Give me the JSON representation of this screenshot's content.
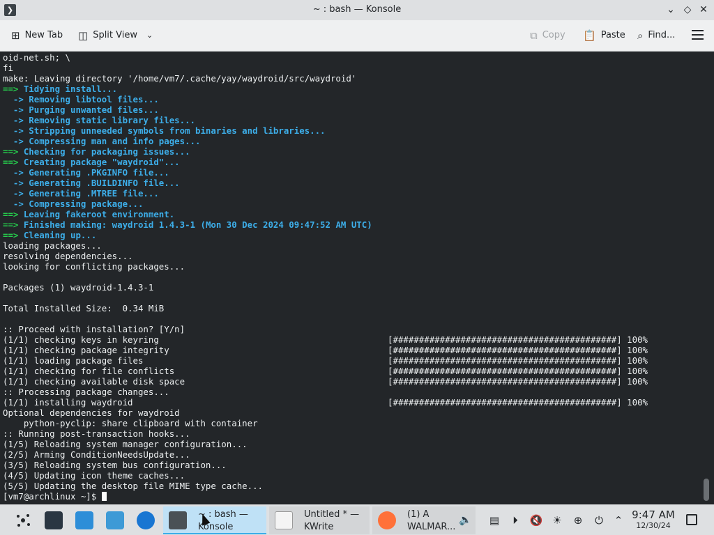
{
  "window": {
    "title": "~ : bash — Konsole",
    "app_icon_glyph": "❯",
    "buttons": {
      "minimize": "⌄",
      "maximize": "◇",
      "close": "✕"
    }
  },
  "toolbar": {
    "new_tab": "New Tab",
    "split_view": "Split View",
    "copy": "Copy",
    "paste": "Paste",
    "find": "Find..."
  },
  "terminal": {
    "colors": {
      "background": "#232629",
      "text": "#eceff0",
      "arrow": "#26cd4d",
      "info": "#3daee9"
    },
    "lines": [
      {
        "t": "oid-net.sh; \\"
      },
      {
        "t": "fi"
      },
      {
        "t": "make: Leaving directory '/home/vm7/.cache/yay/waydroid/src/waydroid'"
      },
      {
        "p": "==>",
        "pc": "arrow",
        "t": " Tidying install...",
        "c": "info"
      },
      {
        "p": "  ->",
        "pc": "info",
        "t": " Removing libtool files...",
        "c": "info"
      },
      {
        "p": "  ->",
        "pc": "info",
        "t": " Purging unwanted files...",
        "c": "info"
      },
      {
        "p": "  ->",
        "pc": "info",
        "t": " Removing static library files...",
        "c": "info"
      },
      {
        "p": "  ->",
        "pc": "info",
        "t": " Stripping unneeded symbols from binaries and libraries...",
        "c": "info"
      },
      {
        "p": "  ->",
        "pc": "info",
        "t": " Compressing man and info pages...",
        "c": "info"
      },
      {
        "p": "==>",
        "pc": "arrow",
        "t": " Checking for packaging issues...",
        "c": "info"
      },
      {
        "p": "==>",
        "pc": "arrow",
        "t": " Creating package \"waydroid\"...",
        "c": "info"
      },
      {
        "p": "  ->",
        "pc": "info",
        "t": " Generating .PKGINFO file...",
        "c": "info"
      },
      {
        "p": "  ->",
        "pc": "info",
        "t": " Generating .BUILDINFO file...",
        "c": "info"
      },
      {
        "p": "  ->",
        "pc": "info",
        "t": " Generating .MTREE file...",
        "c": "info"
      },
      {
        "p": "  ->",
        "pc": "info",
        "t": " Compressing package...",
        "c": "info"
      },
      {
        "p": "==>",
        "pc": "arrow",
        "t": " Leaving fakeroot environment.",
        "c": "info"
      },
      {
        "p": "==>",
        "pc": "arrow",
        "t": " Finished making: waydroid 1.4.3-1 (Mon 30 Dec 2024 09:47:52 AM UTC)",
        "c": "info"
      },
      {
        "p": "==>",
        "pc": "arrow",
        "t": " Cleaning up...",
        "c": "info"
      },
      {
        "t": "loading packages..."
      },
      {
        "t": "resolving dependencies..."
      },
      {
        "t": "looking for conflicting packages..."
      },
      {
        "t": ""
      },
      {
        "t": "Packages (1) waydroid-1.4.3-1"
      },
      {
        "t": ""
      },
      {
        "t": "Total Installed Size:  0.34 MiB"
      },
      {
        "t": ""
      },
      {
        "t": ":: Proceed with installation? [Y/n]"
      },
      {
        "t": "(1/1) checking keys in keyring                                            [###########################################] 100%"
      },
      {
        "t": "(1/1) checking package integrity                                          [###########################################] 100%"
      },
      {
        "t": "(1/1) loading package files                                               [###########################################] 100%"
      },
      {
        "t": "(1/1) checking for file conflicts                                         [###########################################] 100%"
      },
      {
        "t": "(1/1) checking available disk space                                       [###########################################] 100%"
      },
      {
        "t": ":: Processing package changes..."
      },
      {
        "t": "(1/1) installing waydroid                                                 [###########################################] 100%"
      },
      {
        "t": "Optional dependencies for waydroid"
      },
      {
        "t": "    python-pyclip: share clipboard with container"
      },
      {
        "t": ":: Running post-transaction hooks..."
      },
      {
        "t": "(1/5) Reloading system manager configuration..."
      },
      {
        "t": "(2/5) Arming ConditionNeedsUpdate..."
      },
      {
        "t": "(3/5) Reloading system bus configuration..."
      },
      {
        "t": "(4/5) Updating icon theme caches..."
      },
      {
        "t": "(5/5) Updating the desktop file MIME type cache..."
      }
    ],
    "prompt": "[vm7@archlinux ~]$ "
  },
  "taskbar": {
    "tasks": [
      {
        "label": "~ : bash —\nKonsole",
        "active": true
      },
      {
        "label": "Untitled * —\nKWrite",
        "active": false
      },
      {
        "label": "(1) A\nWALMAR...",
        "active": false
      }
    ],
    "clock": {
      "time": "9:47 AM",
      "date": "12/30/24"
    }
  }
}
